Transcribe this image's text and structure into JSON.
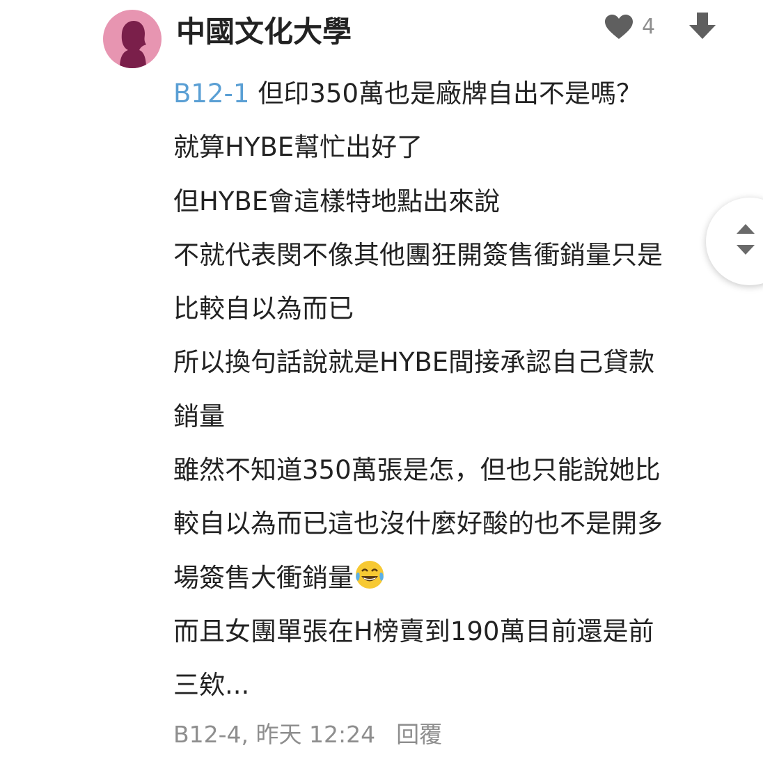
{
  "comment": {
    "author": "中國文化大學",
    "like_count": "4",
    "reply_tag": "B12-1",
    "lines": [
      "但印350萬也是廠牌自出不是嗎？",
      "就算HYBE幫忙出好了",
      "但HYBE會這樣特地點出來說",
      "不就代表閔不像其他團狂開簽售衝銷量只是",
      "比較自以為而已",
      "所以換句話說就是HYBE間接承認自己貸款",
      "銷量",
      "雖然不知道350萬張是怎，但也只能說她比",
      "較自以為而已這也沒什麼好酸的也不是開多",
      "場簽售大衝銷量",
      "而且女團單張在H榜賣到190萬目前還是前",
      "三欸..."
    ],
    "floor_time": "B12-4, 昨天 12:24",
    "reply_label": "回覆"
  },
  "icons": {
    "avatar": "female-silhouette-avatar",
    "like": "heart-icon",
    "download": "download-arrow-icon",
    "emoji": "laughing-tears-emoji",
    "scroll": "scroll-up-down-icon"
  },
  "colors": {
    "avatar_bg": "#e795b1",
    "avatar_figure": "#7a1f4a",
    "reply_tag": "#5a9fd4",
    "meta_text": "#8e8e8e",
    "icon_gray": "#5f5f5f"
  }
}
